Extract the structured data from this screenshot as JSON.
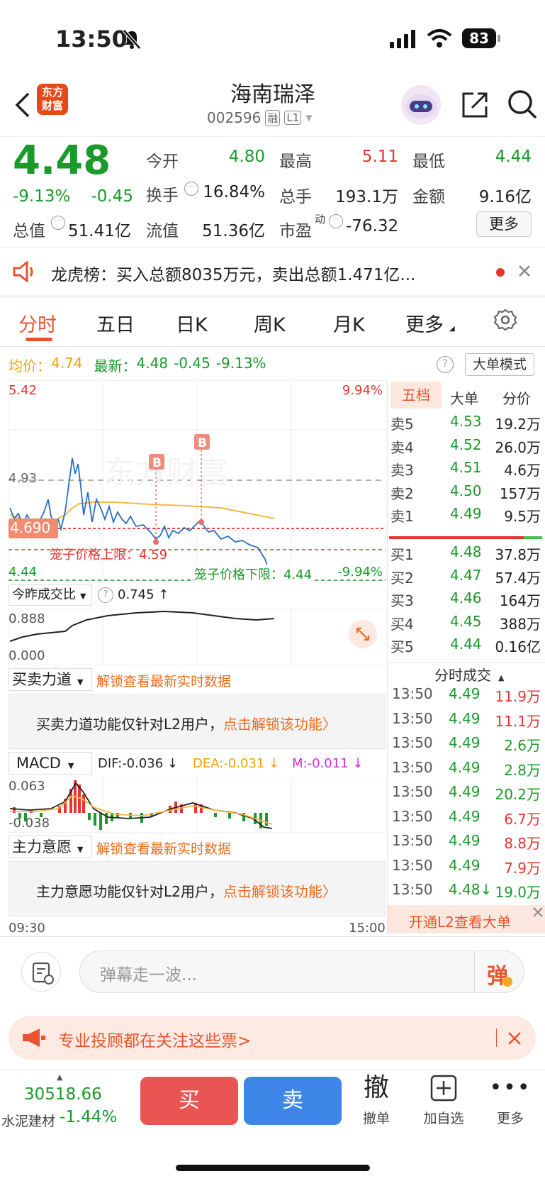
{
  "status": {
    "time": "13:50",
    "battery": "83"
  },
  "header": {
    "title": "海南瑞泽",
    "code": "002596",
    "tag1": "融",
    "tag2": "L1",
    "logo_line1": "东方",
    "logo_line2": "财富"
  },
  "quote": {
    "price": "4.48",
    "pct": "-9.13%",
    "chg": "-0.45",
    "open_label": "今开",
    "open": "4.80",
    "high_label": "最高",
    "high": "5.11",
    "low_label": "最低",
    "low": "4.44",
    "turnover_label": "换手",
    "turnover": "16.84%",
    "volume_label": "总手",
    "volume": "193.1万",
    "amount_label": "金额",
    "amount": "9.16亿",
    "mktcap_label": "总值",
    "mktcap": "51.41亿",
    "float_label": "流值",
    "float": "51.36亿",
    "pe_label": "市盈",
    "pe_sup": "动",
    "pe": "-76.32",
    "more": "更多"
  },
  "notice": {
    "text": "龙虎榜：买入总额8035万元，卖出总额1.471亿..."
  },
  "tabs": [
    "分时",
    "五日",
    "日K",
    "周K",
    "月K",
    "更多"
  ],
  "info": {
    "avg_label": "均价：",
    "avg": "4.74",
    "latest_label": "最新：",
    "latest": "4.48",
    "chg": "-0.45",
    "pct": "-9.13%",
    "big_mode": "大单模式"
  },
  "chart": {
    "top_left": "5.42",
    "top_right": "9.94%",
    "mid_label": "4.93",
    "cur_price": "4.690",
    "bottom_left": "4.44",
    "upper_limit": "笼子价格上限：4.59",
    "lower_limit": "笼子价格下限：4.44",
    "bottom_right": "-9.94%",
    "b_marker": "B",
    "watermark": "东方财富"
  },
  "ratio": {
    "label": "今昨成交比",
    "value": "0.745 ↑",
    "top": "0.888",
    "bottom": "0.000"
  },
  "force": {
    "label": "买卖力道",
    "unlock": "解锁查看最新实时数据",
    "desc": "买卖力道功能仅针对L2用户，",
    "link": "点击解锁该功能"
  },
  "macd": {
    "label": "MACD",
    "dif": "DIF:-0.036 ↓",
    "dea": "DEA:-0.031 ↓",
    "m": "M:-0.011 ↓",
    "top": "0.063",
    "bottom": "-0.038"
  },
  "main_force": {
    "label": "主力意愿",
    "unlock": "解锁查看最新实时数据",
    "desc": "主力意愿功能仅针对L2用户，",
    "link": "点击解锁该功能"
  },
  "time_axis": {
    "start": "09:30",
    "end": "15:00"
  },
  "order_book": {
    "tabs": [
      "五档",
      "大单",
      "分价"
    ],
    "asks": [
      {
        "l": "卖5",
        "p": "4.53",
        "v": "19.2万"
      },
      {
        "l": "卖4",
        "p": "4.52",
        "v": "26.0万"
      },
      {
        "l": "卖3",
        "p": "4.51",
        "v": "4.6万"
      },
      {
        "l": "卖2",
        "p": "4.50",
        "v": "157万"
      },
      {
        "l": "卖1",
        "p": "4.49",
        "v": "9.5万"
      }
    ],
    "bids": [
      {
        "l": "买1",
        "p": "4.48",
        "v": "37.8万"
      },
      {
        "l": "买2",
        "p": "4.47",
        "v": "57.4万"
      },
      {
        "l": "买3",
        "p": "4.46",
        "v": "164万"
      },
      {
        "l": "买4",
        "p": "4.45",
        "v": "388万"
      },
      {
        "l": "买5",
        "p": "4.44",
        "v": "0.16亿"
      }
    ],
    "ticks_title": "分时成交",
    "ticks": [
      {
        "t": "13:50",
        "p": "4.49",
        "v": "11.9万"
      },
      {
        "t": "13:50",
        "p": "4.49",
        "v": "11.1万"
      },
      {
        "t": "13:50",
        "p": "4.49",
        "v": "2.6万"
      },
      {
        "t": "13:50",
        "p": "4.49",
        "v": "2.8万"
      },
      {
        "t": "13:50",
        "p": "4.49",
        "v": "20.2万"
      },
      {
        "t": "13:50",
        "p": "4.49",
        "v": "6.7万"
      },
      {
        "t": "13:50",
        "p": "4.49",
        "v": "8.8万"
      },
      {
        "t": "13:50",
        "p": "4.49",
        "v": "7.9万"
      },
      {
        "t": "13:50",
        "p": "4.48↓",
        "v": "19.0万"
      }
    ],
    "l2_banner": "开通L2查看大单"
  },
  "danmaku": {
    "placeholder": "弹幕走一波...",
    "btn": "弹"
  },
  "promo": {
    "text": "专业投顾都在关注这些票>"
  },
  "bottom": {
    "index_value": "30518.66",
    "index_name": "水泥建材",
    "index_pct": "-1.44%",
    "buy": "买",
    "sell": "卖",
    "cancel_icon": "撤",
    "cancel": "撤单",
    "watch": "加自选",
    "more": "更多"
  }
}
